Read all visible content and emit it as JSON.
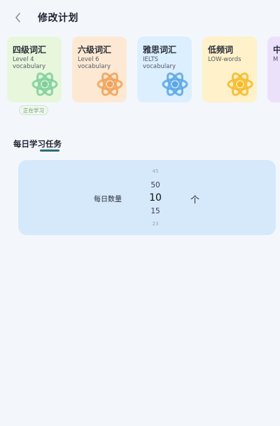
{
  "header": {
    "title": "修改计划",
    "back_icon": "chevron-left-icon"
  },
  "plans": [
    {
      "name": "四级词汇",
      "subtitle": "Level 4 vocabulary",
      "bg": "#e8f7dc",
      "icon_color": "#7fcf9c",
      "icon": "atom-icon"
    },
    {
      "name": "六级词汇",
      "subtitle": "Level 6 vocabulary",
      "bg": "#fde9d3",
      "icon_color": "#f0a25b",
      "icon": "atom-icon"
    },
    {
      "name": "雅思词汇",
      "subtitle": "IELTS vocabulary",
      "bg": "#dcefff",
      "icon_color": "#5aa6e6",
      "icon": "atom-icon"
    },
    {
      "name": "低频词",
      "subtitle": "LOW-words",
      "bg": "#fff1c9",
      "icon_color": "#f4bb2b",
      "icon": "atom-icon"
    },
    {
      "name": "中",
      "subtitle": "M w",
      "bg": "#ece1fb",
      "icon_color": "#a98ad8",
      "icon": "atom-icon"
    }
  ],
  "current_badge": "正在学习",
  "section": {
    "title": "每日学习任务"
  },
  "picker": {
    "label": "每日数量",
    "values": [
      "45",
      "50",
      "10",
      "15",
      "23"
    ],
    "selected": "10",
    "unit": "个"
  }
}
